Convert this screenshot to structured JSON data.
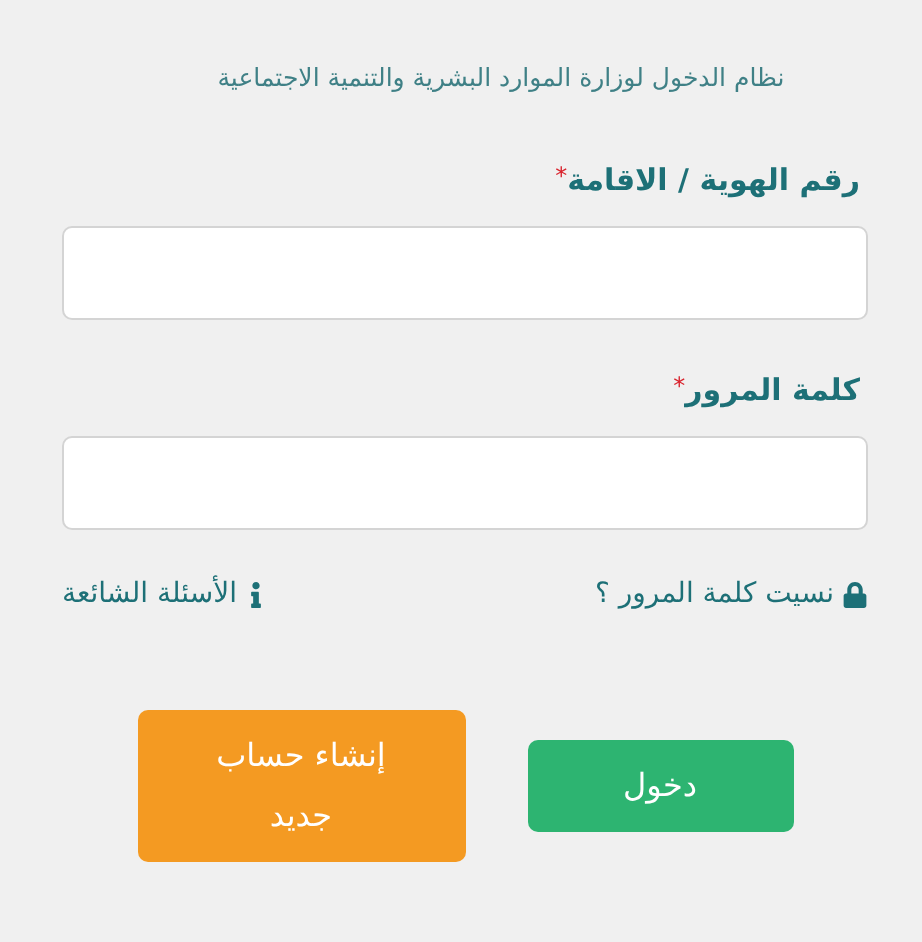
{
  "header": "نظام الدخول لوزارة الموارد البشرية والتنمية الاجتماعية",
  "fields": [
    {
      "label": "رقم الهوية / الاقامة",
      "required_mark": "*"
    },
    {
      "label": "كلمة المرور",
      "required_mark": "*"
    }
  ],
  "links": [
    {
      "label": "نسيت كلمة المرور ؟",
      "kind": "lock"
    },
    {
      "label": "الأسئلة الشائعة",
      "kind": "info"
    }
  ],
  "buttons": [
    {
      "label": "دخول",
      "kind": "primary"
    },
    {
      "label": "إنشاء حساب جديد",
      "kind": "secondary"
    }
  ]
}
